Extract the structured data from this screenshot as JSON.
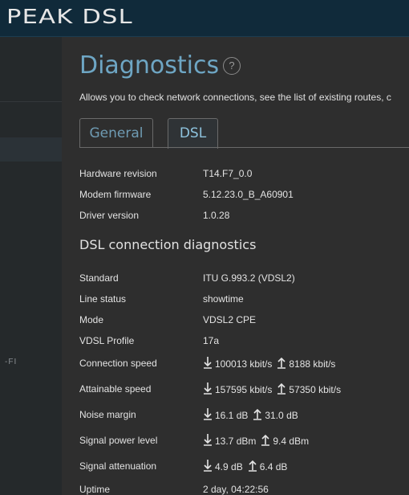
{
  "app": {
    "brand": "PEAK DSL"
  },
  "sidebar": {
    "fragment": "-FI"
  },
  "page": {
    "title": "Diagnostics",
    "help_icon": "?",
    "description": "Allows you to check network connections, see the list of existing routes, c"
  },
  "tabs": [
    {
      "label": "General",
      "active": false
    },
    {
      "label": "DSL",
      "active": true
    }
  ],
  "hardware": [
    {
      "label": "Hardware revision",
      "value": "T14.F7_0.0"
    },
    {
      "label": "Modem firmware",
      "value": "5.12.23.0_B_A60901"
    },
    {
      "label": "Driver version",
      "value": "1.0.28"
    }
  ],
  "diagnostics": {
    "heading": "DSL connection diagnostics",
    "simple": [
      {
        "label": "Standard",
        "value": "ITU G.993.2 (VDSL2)"
      },
      {
        "label": "Line status",
        "value": "showtime"
      },
      {
        "label": "Mode",
        "value": "VDSL2 CPE"
      },
      {
        "label": "VDSL Profile",
        "value": "17a"
      }
    ],
    "paired": [
      {
        "label": "Connection speed",
        "down": "100013 kbit/s",
        "up": "8188 kbit/s"
      },
      {
        "label": "Attainable speed",
        "down": "157595 kbit/s",
        "up": "57350 kbit/s"
      },
      {
        "label": "Noise margin",
        "down": "16.1 dB",
        "up": "31.0 dB"
      },
      {
        "label": "Signal power level",
        "down": "13.7 dBm",
        "up": "9.4 dBm"
      },
      {
        "label": "Signal attenuation",
        "down": "4.9 dB",
        "up": "6.4 dB"
      }
    ],
    "uptime": {
      "label": "Uptime",
      "value": "2 day, 04:22:56"
    }
  },
  "icons": {
    "down": "download-arrow-icon",
    "up": "upload-arrow-icon",
    "help": "help-icon"
  },
  "colors": {
    "accent": "#6ea6c4",
    "topbar": "#102a3a",
    "background": "#2e2e2e"
  }
}
